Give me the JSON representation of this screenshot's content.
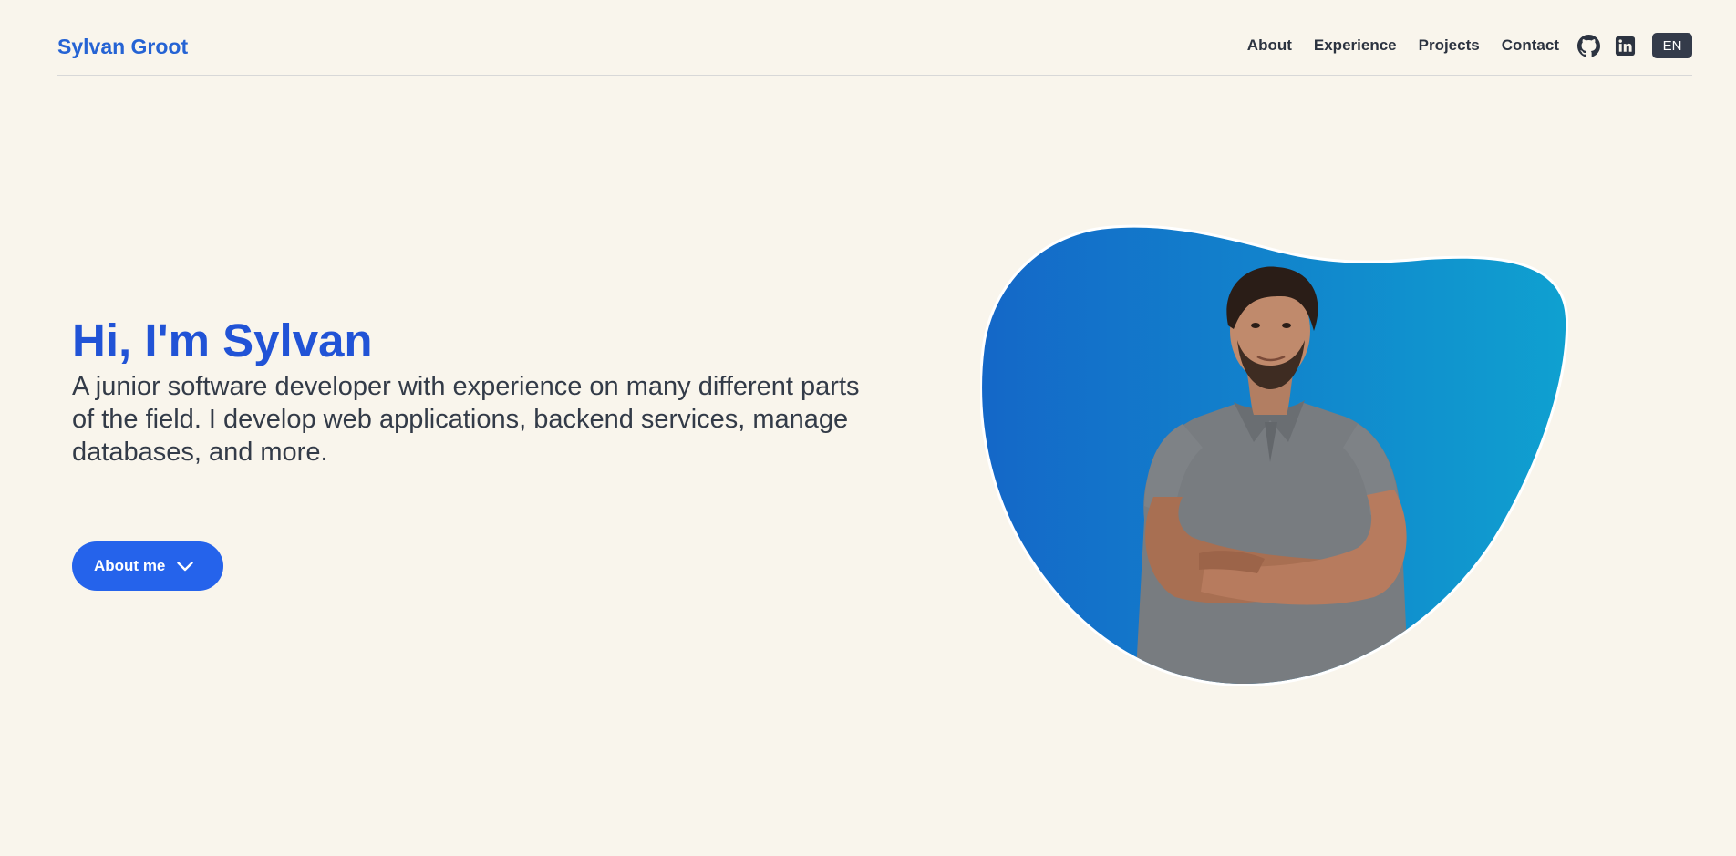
{
  "header": {
    "brand": "Sylvan Groot",
    "nav": {
      "about": "About",
      "experience": "Experience",
      "projects": "Projects",
      "contact": "Contact"
    },
    "icons": [
      "github-icon",
      "linkedin-icon"
    ],
    "language": "EN"
  },
  "hero": {
    "title": "Hi, I'm Sylvan",
    "subtitle": "A junior software developer with experience on many different parts of the field. I develop web applications, backend services, manage databases, and more.",
    "cta_label": "About me",
    "cta_icon": "chevron-down-icon"
  },
  "colors": {
    "background": "#f9f5ec",
    "brand": "#2563d4",
    "title": "#2153d6",
    "button": "#2563eb",
    "text": "#333b48",
    "blob_start": "#1467c8",
    "blob_end": "#0fa1d0"
  }
}
